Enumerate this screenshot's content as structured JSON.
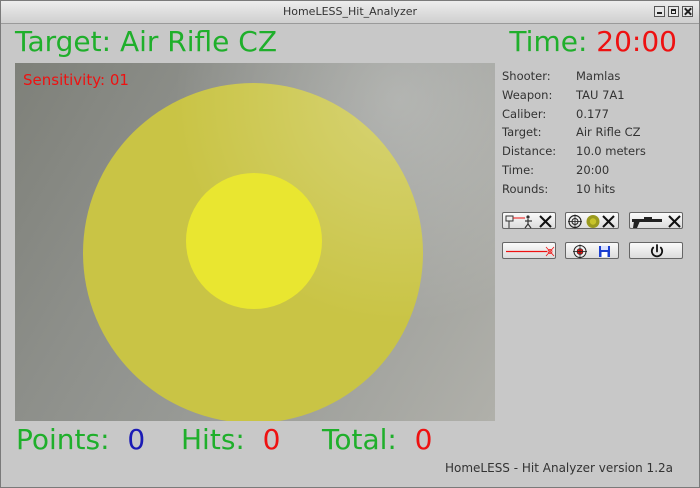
{
  "window": {
    "title": "HomeLESS_Hit_Analyzer",
    "controls": [
      "minimize-icon",
      "maximize-icon",
      "close-icon"
    ]
  },
  "header": {
    "target_label": "Target: Air Rifle CZ",
    "time_label": "Time:",
    "time_value": "20:00"
  },
  "camera": {
    "sensitivity_label": "Sensitivity: 01",
    "target_colors": {
      "outer": "#c9c445",
      "bull": "#e9e630"
    }
  },
  "info": [
    {
      "label": "Shooter:",
      "value": "Mamlas"
    },
    {
      "label": "Weapon:",
      "value": "TAU 7A1"
    },
    {
      "label": "Caliber:",
      "value": "0.177"
    },
    {
      "label": "Target:",
      "value": "Air Rifle CZ"
    },
    {
      "label": "Distance:",
      "value": "10.0 meters"
    },
    {
      "label": "Time:",
      "value": "20:00"
    },
    {
      "label": "Rounds:",
      "value": "10 hits"
    }
  ],
  "toolbar": [
    {
      "name": "shooter-settings-button",
      "icon": "shooter-settings-icon"
    },
    {
      "name": "target-settings-button",
      "icon": "target-settings-icon"
    },
    {
      "name": "weapon-settings-button",
      "icon": "weapon-settings-icon"
    },
    {
      "name": "laser-calibrate-button",
      "icon": "laser-line-icon"
    },
    {
      "name": "save-results-button",
      "icon": "target-save-icon"
    },
    {
      "name": "power-button",
      "icon": "power-icon"
    }
  ],
  "scores": {
    "points_label": "Points:",
    "points_value": "0",
    "hits_label": "Hits:",
    "hits_value": "0",
    "total_label": "Total:",
    "total_value": "0"
  },
  "footer": {
    "version_text": "HomeLESS - Hit Analyzer version 1.2a"
  },
  "colors": {
    "green": "#1faf2b",
    "red": "#ee1111",
    "blue": "#1b1bb5"
  }
}
